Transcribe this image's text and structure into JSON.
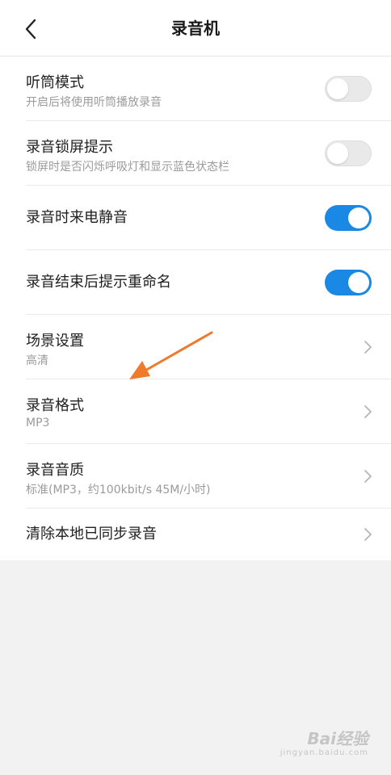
{
  "header": {
    "title": "录音机",
    "back_icon": "chevron-left-icon"
  },
  "settings": [
    {
      "label": "听筒模式",
      "sub": "开启后将使用听筒播放录音",
      "control": "switch",
      "on": false
    },
    {
      "label": "录音锁屏提示",
      "sub": "锁屏时是否闪烁呼吸灯和显示蓝色状态栏",
      "control": "switch",
      "on": false
    },
    {
      "label": "录音时来电静音",
      "control": "switch",
      "on": true
    },
    {
      "label": "录音结束后提示重命名",
      "control": "switch",
      "on": true
    },
    {
      "label": "场景设置",
      "sub": "高清",
      "control": "chevron"
    },
    {
      "label": "录音格式",
      "sub": "MP3",
      "control": "chevron"
    },
    {
      "label": "录音音质",
      "sub": "标准(MP3，约100kbit/s 45M/小时)",
      "control": "chevron"
    },
    {
      "label": "清除本地已同步录音",
      "control": "chevron"
    }
  ],
  "colors": {
    "switch_on": "#1a89e6",
    "switch_off": "#e9e9e9",
    "annotation_arrow": "#f07a2c"
  },
  "watermark": {
    "brand": "Bai经验",
    "sub": "jingyan.baidu.com"
  }
}
